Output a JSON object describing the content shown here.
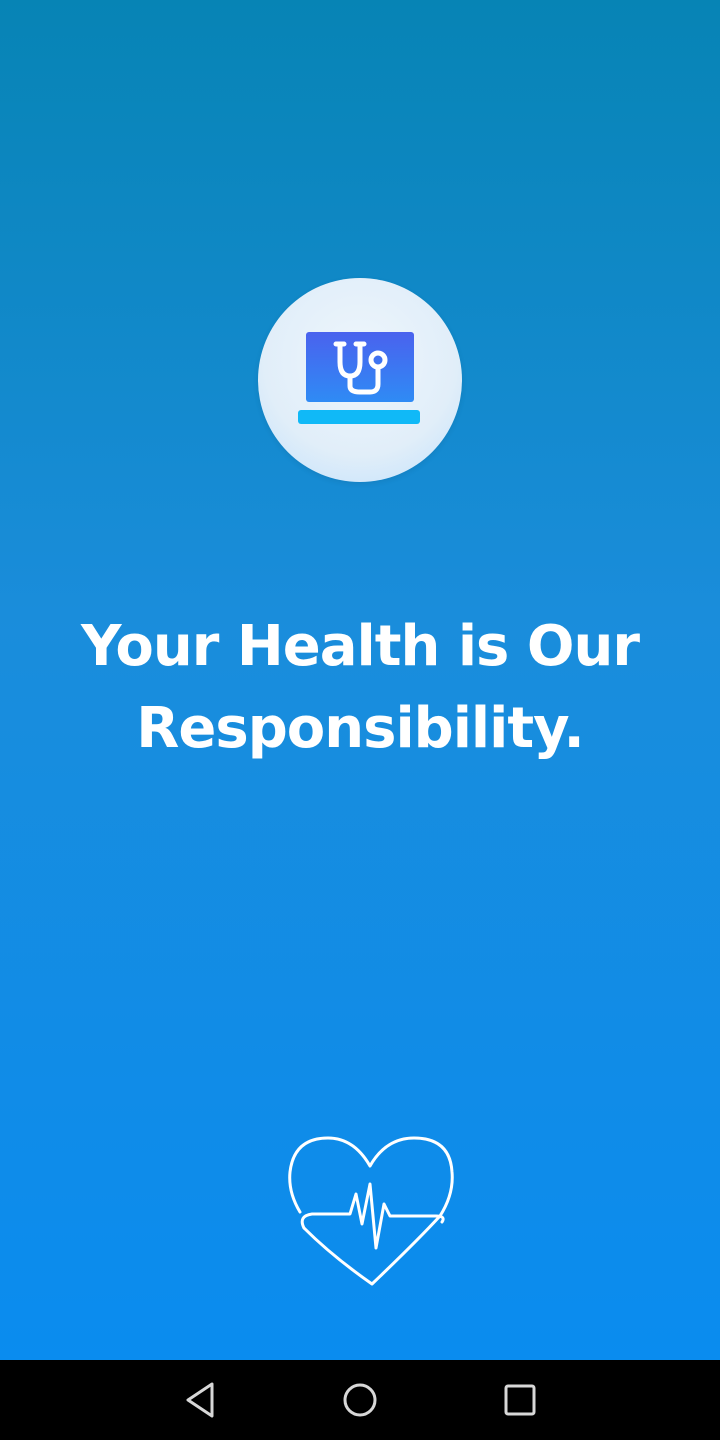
{
  "splash": {
    "tagline": "Your Health is Our Responsibility.",
    "logo_icon": "laptop-stethoscope-icon",
    "footer_icon": "heart-pulse-icon",
    "colors": {
      "gradient_top": "#0784b5",
      "gradient_bottom": "#0a8cef",
      "logo_circle": "#e6f1fa",
      "laptop_screen": "#3f6ef0",
      "laptop_base": "#12b6f5",
      "text": "#ffffff"
    }
  },
  "navigation_bar": {
    "back_icon": "triangle-back-icon",
    "home_icon": "circle-home-icon",
    "recents_icon": "square-recents-icon",
    "background": "#000000"
  }
}
